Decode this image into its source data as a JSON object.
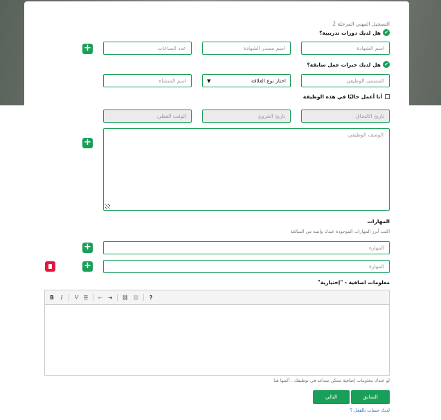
{
  "page": {
    "step_title": "التسجيل المهني المرحلة 2",
    "training": {
      "question": "هل لديك دورات تدريبية؟",
      "cert_name_placeholder": "اسم الشهادة",
      "cert_source_placeholder": "اسم مصدر الشهادة",
      "hours_placeholder": "عدد الساعات"
    },
    "experience": {
      "question": "هل لديك خبرات عمل سابقة؟",
      "job_title_placeholder": "المسمى الوظيفي",
      "relation_type_selected": "اختار نوع العلاقة",
      "company_placeholder": "اسم المنشأة",
      "currently_working_label": "أنا أعمل حاليًا في هذه الوظيفة",
      "join_date_placeholder": "تاريخ الالتحاق",
      "exit_date_placeholder": "تاريخ الخروج",
      "actual_time_placeholder": "الوقت الفعلي",
      "job_description_placeholder": "الوصف الوظيفي"
    },
    "skills": {
      "heading": "المهارات",
      "hint": "اكتب أبرز المهارات الموجودة عندك وانتبه من المبالغة",
      "skill_placeholder_1": "المهارة",
      "skill_placeholder_2": "المهارة"
    },
    "additional": {
      "heading": "معلومات اضافية - \"إختيارية\"",
      "hint": "لو عندك معلومات إضافية ممكن تساعد في توظيفك ، أكتبها هنا",
      "toolbar": {
        "bold": "B",
        "italic": "I",
        "ordered_list": "⅟",
        "bullet_list": "☰",
        "outdent": "⇤",
        "indent": "⇥",
        "link": "⛓",
        "unlink": "⛓",
        "help": "?"
      }
    },
    "buttons": {
      "previous": "السابق",
      "next": "التالي"
    },
    "have_account_link": "لديك حساب بالفعل ؟"
  },
  "colors": {
    "accent": "#1a9f59",
    "danger": "#e0193f",
    "link": "#2a6ecf"
  },
  "icons": {
    "check": "check-circle-icon",
    "plus": "plus-icon",
    "remove": "trash-icon"
  }
}
